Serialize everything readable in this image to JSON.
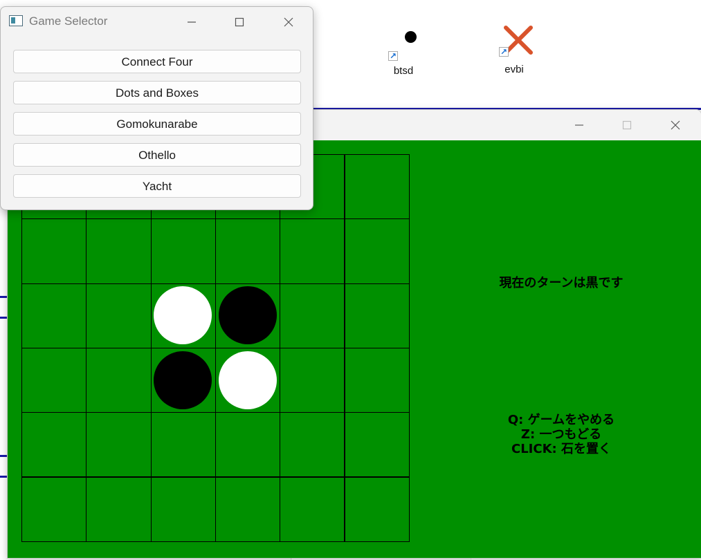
{
  "desktop": {
    "icons": [
      {
        "label": "btsd",
        "icon": "black-dot-icon"
      },
      {
        "label": "evbi",
        "icon": "red-x-icon"
      }
    ]
  },
  "selector_window": {
    "title": "Game Selector",
    "buttons": [
      "Connect Four",
      "Dots and Boxes",
      "Gomokunarabe",
      "Othello",
      "Yacht"
    ]
  },
  "game_window": {
    "title": "",
    "board": {
      "rows": 6,
      "cols": 6,
      "stones": [
        {
          "row": 2,
          "col": 2,
          "color": "white"
        },
        {
          "row": 2,
          "col": 3,
          "color": "black"
        },
        {
          "row": 3,
          "col": 2,
          "color": "black"
        },
        {
          "row": 3,
          "col": 3,
          "color": "white"
        }
      ]
    },
    "turn_text": "現在のターンは黒です",
    "help_lines": [
      "Q: ゲームをやめる",
      "Z: 一つもどる",
      "CLICK: 石を置く"
    ]
  },
  "colors": {
    "board_green": "#009000",
    "accent_blue": "#1a1aa8",
    "icon_red": "#d9532b"
  }
}
